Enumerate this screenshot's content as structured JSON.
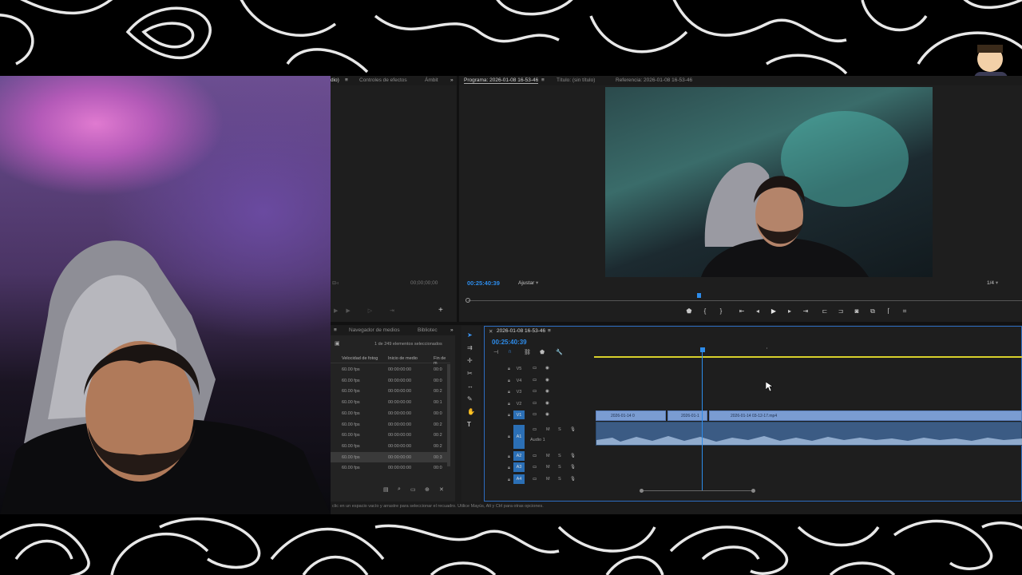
{
  "window": {
    "source_panel_tabs": [
      "dio)",
      "Controles de efectos",
      "Ámbit"
    ],
    "program_panel_tabs": [
      "Programa: 2026-01-08 16-53-46",
      "Título: (sin título)",
      "Referencia: 2026-01-08 16-53-46"
    ],
    "source_timecode": "00;00;00;00",
    "program_timecode": "00:25:40:39",
    "fit_select": "Ajustar",
    "resolution_select": "1/4"
  },
  "project_panel": {
    "tabs": [
      "Navegador de medios",
      "Bibliotec"
    ],
    "selection_count": "1 de 249 elementos seleccionados",
    "columns": [
      "Velocidad de fotog",
      "Inicio de medio",
      "Fin de m"
    ],
    "rows": [
      {
        "fps": "60.00 fps",
        "start": "00:00:00:00",
        "end": "00:0"
      },
      {
        "fps": "60.00 fps",
        "start": "00:00:00:00",
        "end": "00:0"
      },
      {
        "fps": "60.00 fps",
        "start": "00:00:00:00",
        "end": "00:2"
      },
      {
        "fps": "60.00 fps",
        "start": "00:00:00:00",
        "end": "00:1"
      },
      {
        "fps": "60.00 fps",
        "start": "00:00:00:00",
        "end": "00:0"
      },
      {
        "fps": "60.00 fps",
        "start": "00:00:00:00",
        "end": "00:2"
      },
      {
        "fps": "60.00 fps",
        "start": "00:00:00:00",
        "end": "00:2"
      },
      {
        "fps": "60.00 fps",
        "start": "00:00:00:00",
        "end": "00:2"
      },
      {
        "fps": "60.00 fps",
        "start": "00:00:00:00",
        "end": "00:3"
      },
      {
        "fps": "60.00 fps",
        "start": "00:00:00:00",
        "end": "00:0"
      }
    ]
  },
  "timeline": {
    "sequence_tab": "2026-01-08 16-53-46",
    "timecode": "00:25:40:39",
    "video_tracks": [
      "V5",
      "V4",
      "V3",
      "V2",
      "V1"
    ],
    "audio_tracks": [
      "A1",
      "A2",
      "A3",
      "A4"
    ],
    "audio_track_name": "Audio 1",
    "mute_label": "M",
    "solo_label": "S",
    "clips": [
      {
        "label": "2026-01-14 0"
      },
      {
        "label": "2026-01-1"
      },
      {
        "label": "2026-01-14 03-12-17.mp4"
      }
    ]
  },
  "status_bar": {
    "text": "clic en un espacio vacío y arrastre para seleccionar el recuadro. Utilice Mayús, Alt y Ctrl para otras opciones."
  },
  "colors": {
    "accent": "#2d8ceb",
    "clip_video": "#7a9cd2",
    "clip_audio": "#3b5b84",
    "work_area": "#d8d02c"
  }
}
